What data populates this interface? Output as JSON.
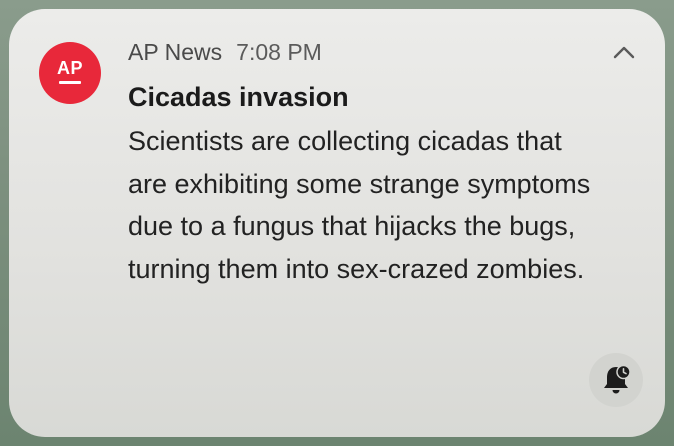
{
  "notification": {
    "app_icon_text": "AP",
    "app_name": "AP News",
    "time": "7:08 PM",
    "title": "Cicadas invasion",
    "body": "Scientists are collecting cicadas that are exhibiting some strange symptoms due to a fungus that hijacks the bugs, turning them into sex-crazed zombies.",
    "collapse_icon": "chevron-up-icon",
    "snooze_icon": "bell-clock-icon"
  },
  "colors": {
    "app_icon_bg": "#e8283a",
    "card_bg": "#e5e5e2"
  }
}
